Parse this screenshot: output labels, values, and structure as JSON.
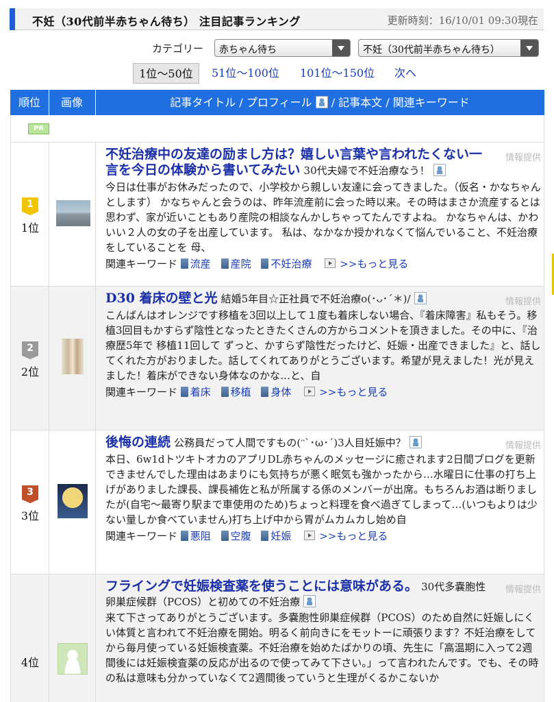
{
  "header": {
    "title": "不妊（30代前半赤ちゃん待ち） 注目記事ランキング",
    "updated": "更新時刻：16/10/01 09:30現在"
  },
  "category": {
    "label": "カテゴリー",
    "select1": "赤ちゃん待ち",
    "select2": "不妊（30代前半赤ちゃん待ち）"
  },
  "pager": {
    "current": "1位〜50位",
    "links": [
      "51位〜100位",
      "101位〜150位",
      "次へ"
    ]
  },
  "table_head": {
    "rank": "順位",
    "image": "画像",
    "title_part1": "記事タイトル / プロフィール",
    "title_part2": "/ 記事本文 / 関連キーワード"
  },
  "pr_badge": "PR",
  "keyword_label": "関連キーワード",
  "more_label": ">>もっと見る",
  "info_label": "情報提供",
  "articles": [
    {
      "rank_num": "1",
      "rank": "1位",
      "title": "不妊治療中の友達の励まし方は？嬉しい言葉や言われたくない一言を今日の体験から書いてみたい",
      "profile": "30代夫婦で不妊治療なう！",
      "body": "今日は仕事がお休みだったので、小学校から親しい友達に会ってきました。（仮名・かなちゃんとします） かなちゃんと会うのは、昨年流産前に会った時以来。その時はまさか流産するとは思わず、家が近いこともあり産院の相談なんかしちゃってたんですよね。 かなちゃんは、かわいい２人の女の子を出産しています。 私は、なかなか授かれなくて悩んでいること、不妊治療をしていることを 母、",
      "keywords": [
        "流産",
        "産院",
        "不妊治療"
      ]
    },
    {
      "rank_num": "2",
      "rank": "2位",
      "title": "D30 着床の壁と光",
      "profile": "結婚5年目☆正社員で不妊治療o(･ᴗ･´＊)/",
      "body": "こんばんはオレンジです移植を3回以上して１度も着床しない場合、『着床障害』私もそう。移植3回目もかすらず陰性となったときたくさんの方からコメントを頂きました。その中に、『治療歴5年で 移植11回して ずっと、かすらず陰性だったけど、妊娠・出産できました』と、話してくれた方がおりました。話してくれてありがとうございます。希望が見えました！光が見えました！着床ができない身体なのかな…と、自",
      "keywords": [
        "着床",
        "移植",
        "身体"
      ]
    },
    {
      "rank_num": "3",
      "rank": "3位",
      "title": "後悔の連続",
      "profile": "公務員だって人間ですもの(ᵔ`･ω･´)3人目妊娠中？",
      "body": "本日、6w1dトツキトオカのアプリDL赤ちゃんのメッセージに癒されます2日間ブログを更新できませんでした理由はあまりにも気持ちが悪く眠気も強かったから…水曜日に仕事の打ち上げがありました課長、課長補佐と私が所属する係のメンバーが出席。もちろんお酒は断りましたが(自宅〜最寄り駅まで車使用のため)ちょっと料理を食べ過ぎてしまって…(いつもよりは少ない量しか食べていません)打ち上げ中から胃がムカムカし始め自",
      "keywords": [
        "悪阻",
        "空腹",
        "妊娠"
      ]
    },
    {
      "rank_num": "4",
      "rank": "4位",
      "title": "フライングで妊娠検査薬を使うことには意味がある。",
      "profile": "30代多嚢胞性卵巣症候群（PCOS）と初めての不妊治療",
      "body": "来て下さってありがとうございます。多嚢胞性卵巣症候群（PCOS）のため自然に妊娠しにくい体質と言われて不妊治療を開始。明るく前向きにをモットーに頑張ります？不妊治療をしてから毎月使っている妊娠検査薬。不妊治療を始めたばかりの頃、先生に「高温期に入って2週間後には妊娠検査薬の反応が出るので使ってみて下さい。」って言われたんです。でも、その時の私は意味も分かっていなくて2週間後っていうと生理がくるかこないか",
      "keywords": []
    }
  ],
  "colors": {
    "accent": "#1f6fe0",
    "link": "#1a3db8",
    "title": "#1a2fa8",
    "gold": "#f2c400",
    "silver": "#9a9a9a",
    "bronze": "#c0502a"
  }
}
